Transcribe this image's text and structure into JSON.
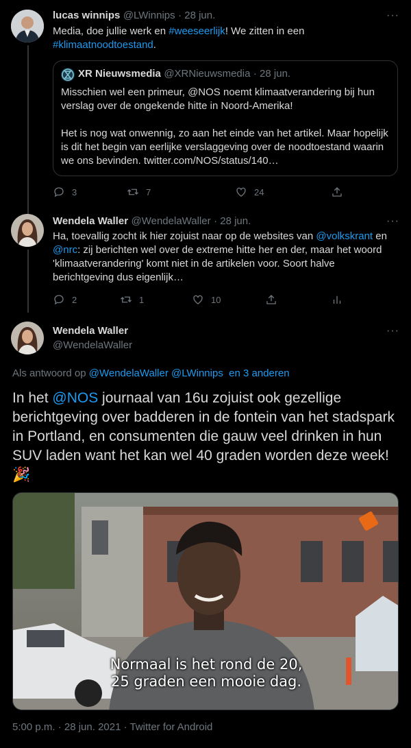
{
  "tweet1": {
    "name": "lucas winnips",
    "handle": "@LWinnips",
    "date": "· 28 jun.",
    "text_a": "Media, doe jullie werk en ",
    "hashtag1": "#weeseerlijk",
    "text_b": "! We zitten in een",
    "hashtag2": "#klimaatnoodtoestand",
    "text_c": ".",
    "quote": {
      "name": "XR Nieuwsmedia",
      "handle": "@XRNieuwsmedia",
      "date": "· 28 jun.",
      "p1": "Misschien wel een primeur, @NOS noemt klimaatverandering bij hun verslag over de ongekende hitte in Noord-Amerika!",
      "p2": "Het is nog wat onwennig, zo aan het einde van het artikel. Maar hopelijk is dit het begin van eerlijke verslaggeving over de noodtoestand waarin we ons bevinden. twitter.com/NOS/status/140…"
    },
    "replies": "3",
    "retweets": "7",
    "likes": "24"
  },
  "tweet2": {
    "name": "Wendela Waller",
    "handle": "@WendelaWaller",
    "date": "· 28 jun.",
    "text_a": "Ha, toevallig zocht ik hier zojuist naar op de websites van ",
    "mention1": "@volkskrant",
    "text_b": " en ",
    "mention2": "@nrc",
    "text_c": ": zij berichten wel over de extreme hitte her en der, maar het woord 'klimaatverandering' komt niet in de artikelen voor. Soort halve berichtgeving dus eigenlijk…",
    "replies": "2",
    "retweets": "1",
    "likes": "10"
  },
  "main": {
    "name": "Wendela Waller",
    "handle": "@WendelaWaller",
    "reply_prefix": "Als antwoord op ",
    "reply_to1": "@WendelaWaller",
    "reply_to2": "@LWinnips",
    "reply_others": "en 3 anderen",
    "text_a": "In het ",
    "mention": "@NOS",
    "text_b": " journaal van 16u zojuist ook gezellige berichtgeving over badderen in de fontein van het stadspark in Portland, en consumenten die gauw veel drinken in hun SUV laden want het kan wel 40 graden worden deze week! ",
    "emoji": "🎉",
    "subtitle1": "Normaal is het rond de 20,",
    "subtitle2": "25 graden een mooie dag.",
    "meta": "5:00 p.m. · 28 jun. 2021 · Twitter for Android"
  },
  "more_label": "···",
  "colors": {
    "link": "#1d9bf0",
    "muted": "#6e767d",
    "background": "#000000"
  }
}
